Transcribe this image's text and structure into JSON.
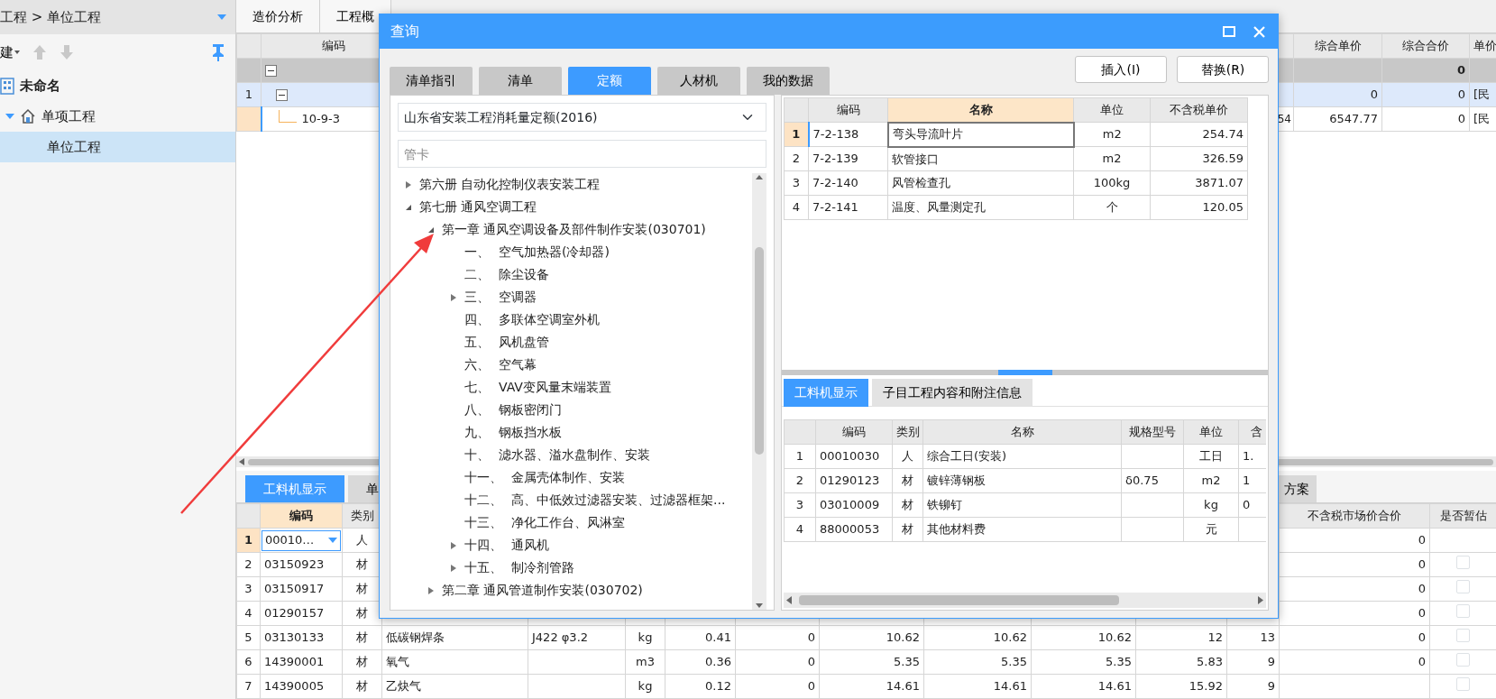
{
  "sidebar": {
    "breadcrumb": "工程 > 单位工程",
    "toolbar_label": "建",
    "tree": [
      {
        "label": "未命名",
        "kind": "project",
        "selected": false,
        "children": [
          {
            "label": "单项工程",
            "kind": "section",
            "expanded": true,
            "selected": false,
            "children": [
              {
                "label": "单位工程",
                "selected": true
              }
            ]
          }
        ]
      }
    ]
  },
  "main_tabs": [
    {
      "label": "造价分析",
      "selected": false
    },
    {
      "label": "工程概",
      "selected": false
    }
  ],
  "top_table": {
    "columns": [
      null,
      "编码",
      null,
      null,
      "综合单价",
      "综合合价",
      "单价"
    ],
    "rows": [
      {
        "kind": "group",
        "selected": false,
        "focused": false,
        "cells": [
          null,
          null,
          null,
          null,
          null,
          "0",
          null
        ]
      },
      {
        "kind": "item",
        "selected": true,
        "focused": false,
        "cells": [
          "1",
          null,
          null,
          null,
          "0",
          "0",
          "[民"
        ]
      },
      {
        "kind": "sub",
        "selected": false,
        "focused": true,
        "cells": [
          null,
          "10-9-3",
          null,
          "54",
          "6547.77",
          "0",
          "[民"
        ]
      }
    ]
  },
  "bottom_panel": {
    "tabs": [
      {
        "label": "工料机显示",
        "selected": true
      },
      {
        "label": "单",
        "selected": false
      },
      {
        "label": "方案",
        "selected": false
      }
    ],
    "columns": [
      {
        "label": "编码",
        "selected": true
      },
      {
        "label": "类别",
        "selected": false
      },
      null,
      null,
      null,
      null,
      null,
      null,
      null,
      null,
      null,
      null,
      {
        "label": "不含税市场价合价",
        "selected": false
      },
      {
        "label": "是否暂估",
        "selected": false
      }
    ],
    "rows": [
      {
        "num": "1",
        "selected": true,
        "editing": true,
        "cells": [
          "00010…",
          "人",
          null,
          null,
          null,
          null,
          null,
          null,
          null,
          null,
          null,
          null,
          "0"
        ]
      },
      {
        "num": "2",
        "selected": false,
        "editing": false,
        "estimated": false,
        "cells": [
          "03150923",
          "材",
          null,
          null,
          null,
          null,
          null,
          null,
          null,
          null,
          null,
          null,
          "0"
        ]
      },
      {
        "num": "3",
        "selected": false,
        "editing": false,
        "estimated": false,
        "cells": [
          "03150917",
          "材",
          null,
          null,
          null,
          null,
          null,
          null,
          null,
          null,
          null,
          null,
          "0"
        ]
      },
      {
        "num": "4",
        "selected": false,
        "editing": false,
        "estimated": false,
        "cells": [
          "01290157",
          "材",
          null,
          null,
          null,
          null,
          null,
          null,
          null,
          null,
          null,
          null,
          "0"
        ]
      },
      {
        "num": "5",
        "selected": false,
        "editing": false,
        "estimated": false,
        "cells": [
          "03130133",
          "材",
          "低碳钢焊条",
          "J422 φ3.2",
          "kg",
          "0.41",
          "0",
          "10.62",
          "10.62",
          "10.62",
          "12",
          "13",
          "0"
        ]
      },
      {
        "num": "6",
        "selected": false,
        "editing": false,
        "estimated": false,
        "cells": [
          "14390001",
          "材",
          "氧气",
          null,
          "m3",
          "0.36",
          "0",
          "5.35",
          "5.35",
          "5.35",
          "5.83",
          "9",
          "0"
        ]
      },
      {
        "num": "7",
        "selected": false,
        "editing": false,
        "estimated": false,
        "cells": [
          "14390005",
          "材",
          "乙炔气",
          null,
          "kg",
          "0.12",
          "0",
          "14.61",
          "14.61",
          "14.61",
          "15.92",
          "9",
          null
        ]
      }
    ]
  },
  "dialog": {
    "title": "查询",
    "tabs": [
      {
        "label": "清单指引",
        "selected": false
      },
      {
        "label": "清单",
        "selected": false
      },
      {
        "label": "定额",
        "selected": true
      },
      {
        "label": "人材机",
        "selected": false
      },
      {
        "label": "我的数据",
        "selected": false
      }
    ],
    "buttons": [
      "插入(I)",
      "替换(R)"
    ],
    "library": "山东省安装工程消耗量定额(2016)",
    "search": {
      "placeholder": "管卡"
    },
    "tree": [
      {
        "label": "第六册 自动化控制仪表安装工程",
        "expanded": false
      },
      {
        "label": "第七册 通风空调工程",
        "expanded": true,
        "children": [
          {
            "label": "第一章 通风空调设备及部件制作安装(030701)",
            "expanded": true,
            "children": [
              {
                "number": "一、",
                "label": "空气加热器(冷却器)"
              },
              {
                "number": "二、",
                "label": "除尘设备"
              },
              {
                "number": "三、",
                "label": "空调器",
                "expanded": false
              },
              {
                "number": "四、",
                "label": "多联体空调室外机"
              },
              {
                "number": "五、",
                "label": "风机盘管"
              },
              {
                "number": "六、",
                "label": "空气幕"
              },
              {
                "number": "七、",
                "label": "VAV变风量末端装置"
              },
              {
                "number": "八、",
                "label": "钢板密闭门"
              },
              {
                "number": "九、",
                "label": "钢板挡水板"
              },
              {
                "number": "十、",
                "label": "滤水器、溢水盘制作、安装"
              },
              {
                "number": "十一、",
                "label": "金属壳体制作、安装"
              },
              {
                "number": "十二、",
                "label": "高、中低效过滤器安装、过滤器框架..."
              },
              {
                "number": "十三、",
                "label": "净化工作台、风淋室"
              },
              {
                "number": "十四、",
                "label": "通风机",
                "expanded": false
              },
              {
                "number": "十五、",
                "label": "制冷剂管路",
                "expanded": false
              }
            ]
          },
          {
            "label": "第二章 通风管道制作安装(030702)",
            "expanded": false
          }
        ]
      }
    ],
    "quota_table": {
      "columns": [
        {
          "label": "编码",
          "selected": false
        },
        {
          "label": "名称",
          "selected": true
        },
        {
          "label": "单位",
          "selected": false
        },
        {
          "label": "不含税单价",
          "selected": false
        }
      ],
      "rows": [
        {
          "num": "1",
          "selected": true,
          "cells": [
            "7-2-138",
            "弯头导流叶片",
            "m2",
            "254.74"
          ]
        },
        {
          "num": "2",
          "selected": false,
          "cells": [
            "7-2-139",
            "软管接口",
            "m2",
            "326.59"
          ]
        },
        {
          "num": "3",
          "selected": false,
          "cells": [
            "7-2-140",
            "风管检查孔",
            "100kg",
            "3871.07"
          ]
        },
        {
          "num": "4",
          "selected": false,
          "cells": [
            "7-2-141",
            "温度、风量测定孔",
            "个",
            "120.05"
          ]
        }
      ]
    },
    "detail_tabs": [
      {
        "label": "工料机显示",
        "selected": true
      },
      {
        "label": "子目工程内容和附注信息",
        "selected": false
      }
    ],
    "resource_table": {
      "columns": [
        {
          "label": "编码",
          "selected": false
        },
        {
          "label": "类别",
          "selected": false
        },
        {
          "label": "名称",
          "selected": false
        },
        {
          "label": "规格型号",
          "selected": false
        },
        {
          "label": "单位",
          "selected": false
        },
        {
          "label": "含",
          "selected": false
        }
      ],
      "rows": [
        {
          "num": "1",
          "cells": [
            "00010030",
            "人",
            "综合工日(安装)",
            null,
            "工日",
            "1."
          ]
        },
        {
          "num": "2",
          "cells": [
            "01290123",
            "材",
            "镀锌薄钢板",
            "δ0.75",
            "m2",
            "1"
          ]
        },
        {
          "num": "3",
          "cells": [
            "03010009",
            "材",
            "铁铆钉",
            null,
            "kg",
            "0"
          ]
        },
        {
          "num": "4",
          "cells": [
            "88000053",
            "材",
            "其他材料费",
            null,
            "元",
            null
          ]
        }
      ]
    }
  }
}
